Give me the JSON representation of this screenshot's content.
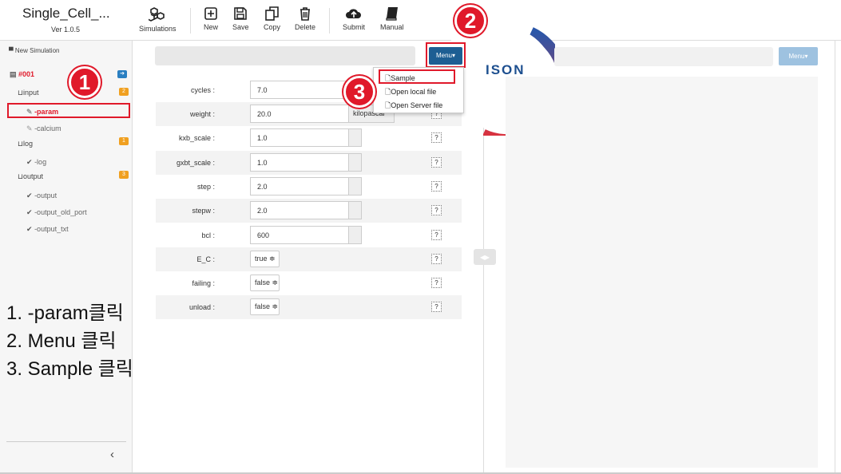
{
  "app": {
    "title": "Single_Cell_...",
    "version": "Ver 1.0.5"
  },
  "toolbar": {
    "simulations": "Simulations",
    "new": "New",
    "save": "Save",
    "copy": "Copy",
    "delete": "Delete",
    "submit": "Submit",
    "manual": "Manual"
  },
  "sidebar": {
    "new_simulation": "New Simulation",
    "sim_id": "#001",
    "input_label": "input",
    "input_count": "2",
    "param": "-param",
    "calcium": "-calcium",
    "log_label": "log",
    "log_count": "1",
    "log_item": "-log",
    "output_label": "output",
    "output_count": "3",
    "outputs": [
      "-output",
      "-output_old_port",
      "-output_txt"
    ],
    "collapse_glyph": "‹"
  },
  "params": [
    {
      "label": "cycles :",
      "value": "7.0",
      "unit": ""
    },
    {
      "label": "weight :",
      "value": "20.0",
      "unit": "kilopascal"
    },
    {
      "label": "kxb_scale :",
      "value": "1.0",
      "unit": ""
    },
    {
      "label": "gxbt_scale :",
      "value": "1.0",
      "unit": ""
    },
    {
      "label": "step :",
      "value": "2.0",
      "unit": ""
    },
    {
      "label": "stepw :",
      "value": "2.0",
      "unit": ""
    },
    {
      "label": "bcl :",
      "value": "600",
      "unit": ""
    },
    {
      "label": "E_C :",
      "value": "true ≑",
      "unit": ""
    },
    {
      "label": "failing :",
      "value": "false ≑",
      "unit": ""
    },
    {
      "label": "unload :",
      "value": "false ≑",
      "unit": ""
    }
  ],
  "help_glyph": "?",
  "menu": {
    "button": "Menu▾",
    "items": [
      "Sample",
      "Open local file",
      "Open Server file"
    ]
  },
  "right": {
    "menu_button": "Menu▾",
    "logo_text": "ISON"
  },
  "annotations": {
    "markers": [
      "1",
      "2",
      "3"
    ],
    "instructions": [
      "1. -param클릭",
      "2. Menu 클릭",
      "3. Sample 클릭"
    ]
  },
  "colors": {
    "accent_red": "#e0192a",
    "menu_blue": "#1d5e93",
    "badge_blue": "#2a7fc1",
    "badge_orange": "#f0a020"
  }
}
